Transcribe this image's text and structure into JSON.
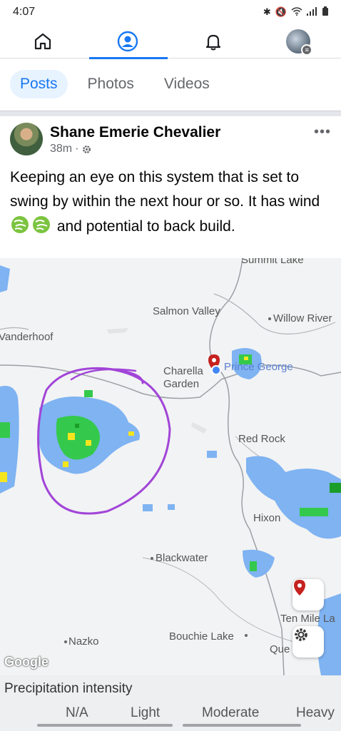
{
  "status_bar": {
    "time": "4:07"
  },
  "nav": {
    "items": [
      "home",
      "profile",
      "notifications",
      "account"
    ],
    "accent": "#1877f2"
  },
  "tabs": [
    {
      "label": "Posts",
      "active": true
    },
    {
      "label": "Photos",
      "active": false
    },
    {
      "label": "Videos",
      "active": false
    }
  ],
  "post": {
    "author": "Shane Emerie Chevalier",
    "time": "38m",
    "text_before_emoji": "Keeping an eye on this system that is set to swing by within the next hour or so. It has wind",
    "text_after_emoji": "and potential to back build.",
    "emoji": "wind-emoji"
  },
  "map": {
    "labels": {
      "summit_lake": "Summit Lake",
      "salmon_valley": "Salmon Valley",
      "willow_river": "Willow River",
      "vanderhoof": "Vanderhoof",
      "charella_garden": "Charella Garden",
      "prince_george": "Prince George",
      "red_rock": "Red Rock",
      "hixon": "Hixon",
      "blackwater": "Blackwater",
      "ten_mile_lake": "Ten Mile La",
      "nazko": "Nazko",
      "bouchie_lake": "Bouchie Lake",
      "quesnel": "Que"
    },
    "attribution": "Google"
  },
  "legend": {
    "title": "Precipitation intensity",
    "scale": [
      "N/A",
      "Light",
      "Moderate",
      "Heavy"
    ]
  }
}
